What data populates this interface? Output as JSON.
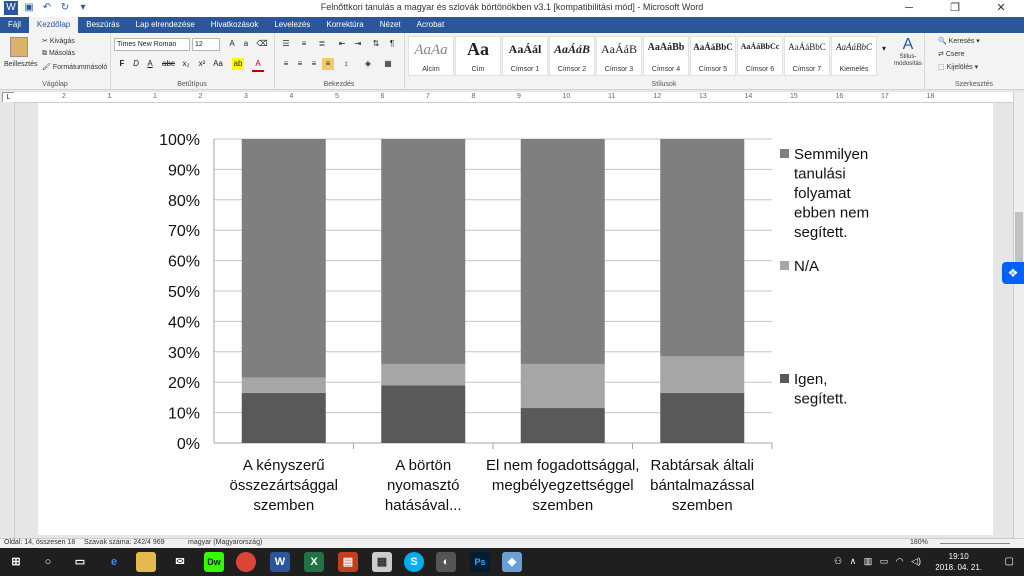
{
  "window": {
    "title": "Felnőttkori tanulás a magyar és szlovák börtönökben v3.1 [kompatibilitási mód] - Microsoft Word",
    "controls": [
      "─",
      "❐",
      "✕"
    ]
  },
  "tabs": [
    "Fájl",
    "Kezdőlap",
    "Beszúrás",
    "Lap elrendezése",
    "Hivatkozások",
    "Levelezés",
    "Korrektúra",
    "Nézet",
    "Acrobat"
  ],
  "ribbon": {
    "clipboard": {
      "paste": "Beillesztés",
      "cut": "Kivágás",
      "copy": "Másolás",
      "format_painter": "Formátummásoló",
      "label": "Vágólap"
    },
    "font": {
      "name": "Times New Roman",
      "size": "12",
      "label": "Betűtípus"
    },
    "paragraph": {
      "label": "Bekezdés"
    },
    "styles": {
      "label": "Stílusok",
      "items": [
        {
          "preview": "AaAa",
          "name": "Alcím"
        },
        {
          "preview": "Aa",
          "name": "Cím"
        },
        {
          "preview": "AaÁál",
          "name": "Címsor 1"
        },
        {
          "preview": "AaÁáB",
          "name": "Címsor 2"
        },
        {
          "preview": "AaÁáB",
          "name": "Címsor 3"
        },
        {
          "preview": "AaÁáBb",
          "name": "Címsor 4"
        },
        {
          "preview": "AaÁáBbC",
          "name": "Címsor 5"
        },
        {
          "preview": "AaÁáBbCc",
          "name": "Címsor 6"
        },
        {
          "preview": "AaÁáBbC",
          "name": "Címsor 7"
        },
        {
          "preview": "AaÁáBbC",
          "name": "Kiemelés"
        }
      ],
      "change_styles": "Stílus-módosítás"
    },
    "editing": {
      "find": "Keresés",
      "replace": "Csere",
      "select": "Kijelölés",
      "label": "Szerkesztés"
    }
  },
  "ruler_numbers": [
    "2",
    "1",
    "1",
    "2",
    "3",
    "4",
    "5",
    "6",
    "7",
    "8",
    "9",
    "10",
    "11",
    "12",
    "13",
    "14",
    "15",
    "16",
    "17",
    "18"
  ],
  "chart_data": {
    "type": "bar",
    "stacked": true,
    "percent": true,
    "categories": [
      [
        "A kényszerű",
        "összezártsággal",
        "szemben"
      ],
      [
        "A börtön",
        "nyomasztó",
        "hatásával..."
      ],
      [
        "El nem fogadottsággal,",
        "megbélyegzettséggel",
        "szemben"
      ],
      [
        "Rabtársak általi",
        "bántalmazással",
        "szemben"
      ]
    ],
    "series": [
      {
        "name": "Igen, segített.",
        "legend_lines": [
          "Igen,",
          "segített."
        ],
        "color": "#595959",
        "values": [
          16.5,
          19,
          11.5,
          16.5
        ]
      },
      {
        "name": "N/A",
        "legend_lines": [
          "N/A"
        ],
        "color": "#a6a6a6",
        "values": [
          5,
          7,
          14.5,
          12
        ]
      },
      {
        "name": "Semmilyen tanulási folyamat ebben nem segített.",
        "legend_lines": [
          "Semmilyen",
          "tanulási",
          "folyamat",
          "ebben nem",
          "segített."
        ],
        "color": "#7f7f7f",
        "values": [
          78.5,
          74,
          74,
          71.5
        ]
      }
    ],
    "yticks": [
      "0%",
      "10%",
      "20%",
      "30%",
      "40%",
      "50%",
      "60%",
      "70%",
      "80%",
      "90%",
      "100%"
    ],
    "ylim": [
      0,
      100
    ],
    "grid": true,
    "legend": "right"
  },
  "statusbar": {
    "page": "Oldal: 14, összesen 18",
    "words": "Szavak száma: 242/4 969",
    "language": "magyar (Magyarország)",
    "zoom": "180%"
  },
  "taskbar": {
    "time": "19:10",
    "date": "2018. 04. 21."
  }
}
